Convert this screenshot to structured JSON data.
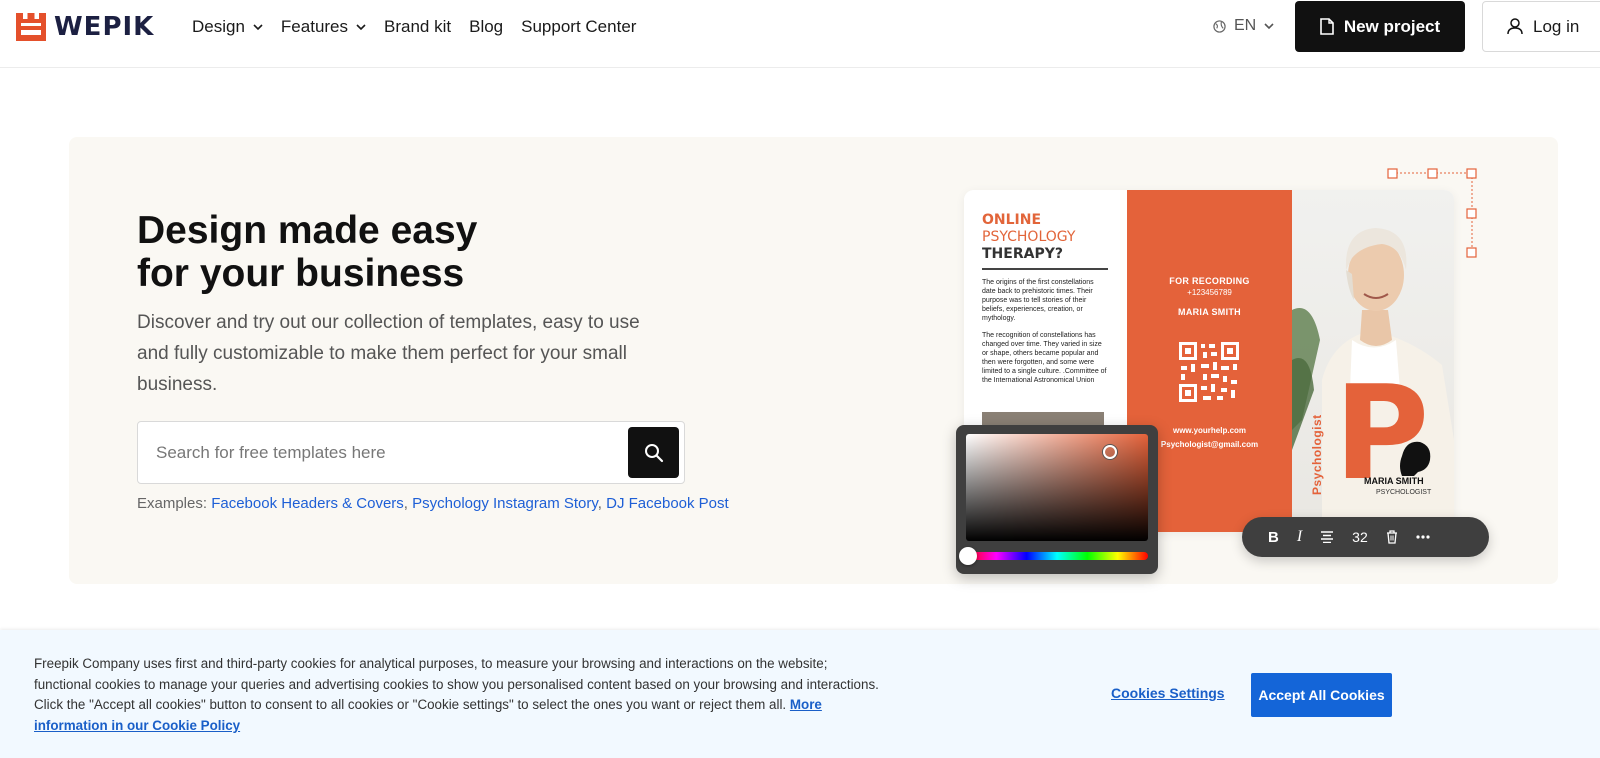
{
  "header": {
    "logo_text": "WEPIK",
    "nav": [
      {
        "label": "Design",
        "has_dropdown": true
      },
      {
        "label": "Features",
        "has_dropdown": true
      },
      {
        "label": "Brand kit",
        "has_dropdown": false
      },
      {
        "label": "Blog",
        "has_dropdown": false
      },
      {
        "label": "Support Center",
        "has_dropdown": false
      }
    ],
    "language": "EN",
    "new_project_label": "New project",
    "login_label": "Log in"
  },
  "hero": {
    "title_line1": "Design made easy",
    "title_line2": "for your business",
    "subtitle": "Discover and try out our collection of templates, easy to use and fully customizable to make them perfect for your small business.",
    "search_placeholder": "Search for free templates here",
    "examples_prefix": "Examples: ",
    "examples": [
      "Facebook Headers & Covers",
      "Psychology Instagram Story",
      "DJ Facebook Post"
    ]
  },
  "mockup": {
    "title_l1": "ONLINE",
    "title_l2": "PSYCHOLOGY",
    "title_l3": "THERAPY?",
    "para1": "The origins of the first constellations date back to prehistoric times. Their purpose was to tell stories of their beliefs, experiences, creation, or mythology.",
    "para2": "The recognition of constellations has changed over time. They varied in size or shape, others became popular and then were forgotten, and some were limited to a single culture. .Committee of the International Astronomical Union",
    "recording_label": "FOR RECORDING",
    "phone": "+123456789",
    "mid_name": "MARIA SMITH",
    "website": "www.yourhelp.com",
    "email": "Psychologist@gmail.com",
    "vertical_label": "Psychologist",
    "person_name": "MARIA SMITH",
    "person_role": "PSYCHOLOGIST",
    "font_size_value": "32",
    "accent_color": "#e4623a"
  },
  "cookie": {
    "text": "Freepik Company uses first and third-party cookies for analytical purposes, to measure your browsing and interactions on the website; functional cookies to manage your queries and advertising cookies to show you personalised content based on your browsing and interactions. Click the \"Accept all cookies\" button to consent to all cookies or \"Cookie settings\" to select the ones you want or reject them all. ",
    "policy_link": "More information in our Cookie Policy",
    "settings_label": "Cookies Settings",
    "accept_label": "Accept All Cookies"
  },
  "icons": {
    "logo": "wepik-logo-icon",
    "globe": "globe-icon",
    "document": "document-icon",
    "user": "user-icon",
    "search": "search-icon",
    "bold": "bold-icon",
    "italic": "italic-icon",
    "align": "align-center-icon",
    "trash": "trash-icon",
    "more": "more-icon"
  }
}
